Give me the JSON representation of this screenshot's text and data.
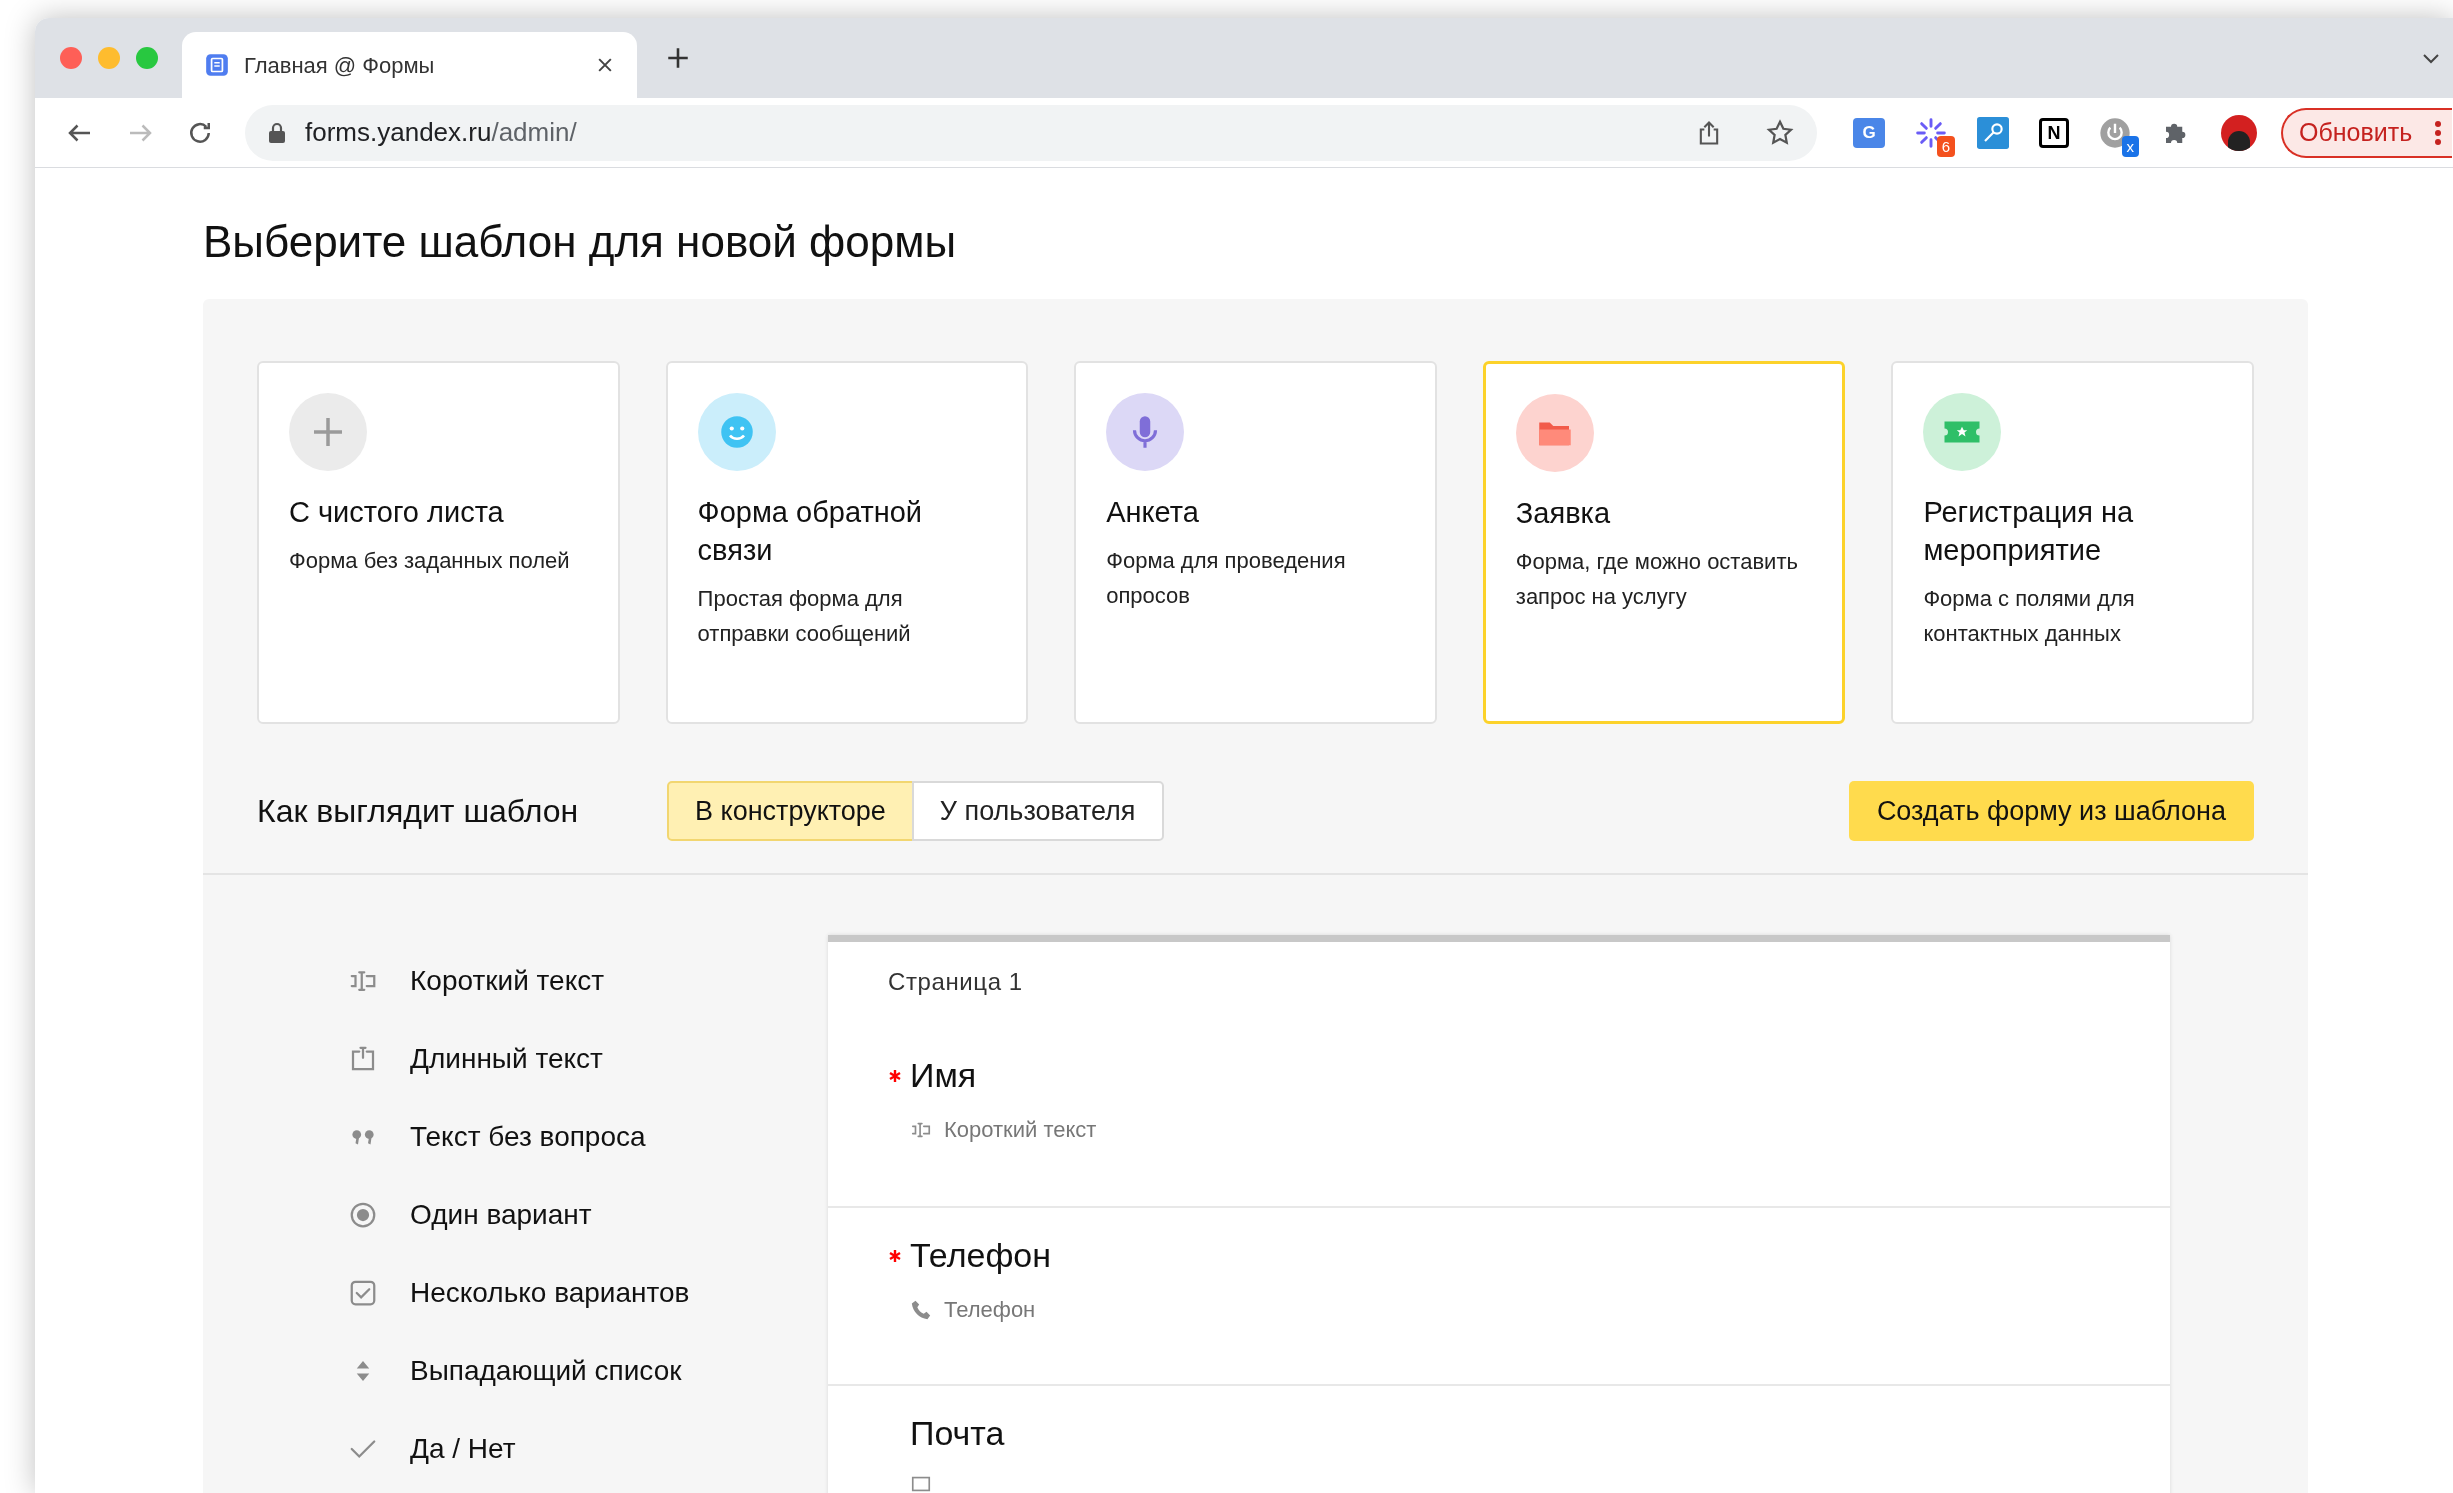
{
  "browser": {
    "tabs": [
      {
        "title": "Главная @ Формы",
        "selected": true
      }
    ],
    "url": {
      "host": "forms.yandex.ru",
      "path": "/admin/"
    },
    "extensions": [
      {
        "kind": "translate",
        "glyph": "G"
      },
      {
        "kind": "sparkle",
        "badge": "6"
      },
      {
        "kind": "key"
      },
      {
        "kind": "notion",
        "glyph": "N"
      },
      {
        "kind": "power",
        "badge": "x"
      },
      {
        "kind": "puzzle"
      },
      {
        "kind": "avatar"
      }
    ],
    "update_button": "Обновить"
  },
  "heading": "Выберите шаблон для новой формы",
  "templates": [
    {
      "kind": "plus",
      "title": "С чистого листа",
      "description": "Форма без заданных полей",
      "selected": false,
      "color": "#ebebeb"
    },
    {
      "kind": "smile",
      "title": "Форма обратной связи",
      "description": "Простая форма для отправки сообщений",
      "selected": false,
      "color": "#cbeefb"
    },
    {
      "kind": "mic",
      "title": "Анкета",
      "description": "Форма для проведения опросов",
      "selected": false,
      "color": "#dcd8f6"
    },
    {
      "kind": "folder",
      "title": "Заявка",
      "description": "Форма, где можно оставить запрос на услугу",
      "selected": true,
      "color": "#fdd3cf"
    },
    {
      "kind": "ticket",
      "title": "Регистрация на мероприятие",
      "description": "Форма с полями для контактных данных",
      "selected": false,
      "color": "#cdf1d9"
    }
  ],
  "preview": {
    "label": "Как выглядит шаблон",
    "modes": [
      {
        "label": "В конструкторе",
        "selected": true
      },
      {
        "label": "У пользователя",
        "selected": false
      }
    ],
    "create_button": "Создать форму из шаблона"
  },
  "field_types": [
    {
      "kind": "short",
      "label": "Короткий текст"
    },
    {
      "kind": "long",
      "label": "Длинный текст"
    },
    {
      "kind": "quote",
      "label": "Текст без вопроса"
    },
    {
      "kind": "radio",
      "label": "Один вариант"
    },
    {
      "kind": "checkbox",
      "label": "Несколько вариантов"
    },
    {
      "kind": "select",
      "label": "Выпадающий список"
    },
    {
      "kind": "check",
      "label": "Да / Нет"
    }
  ],
  "form": {
    "page_title": "Страница 1",
    "questions": [
      {
        "label": "Имя",
        "required": true,
        "kind": "short",
        "type_label": "Короткий текст"
      },
      {
        "label": "Телефон",
        "required": true,
        "kind": "phone",
        "type_label": "Телефон"
      },
      {
        "label": "Почта",
        "required": false,
        "kind": "mail"
      }
    ]
  }
}
